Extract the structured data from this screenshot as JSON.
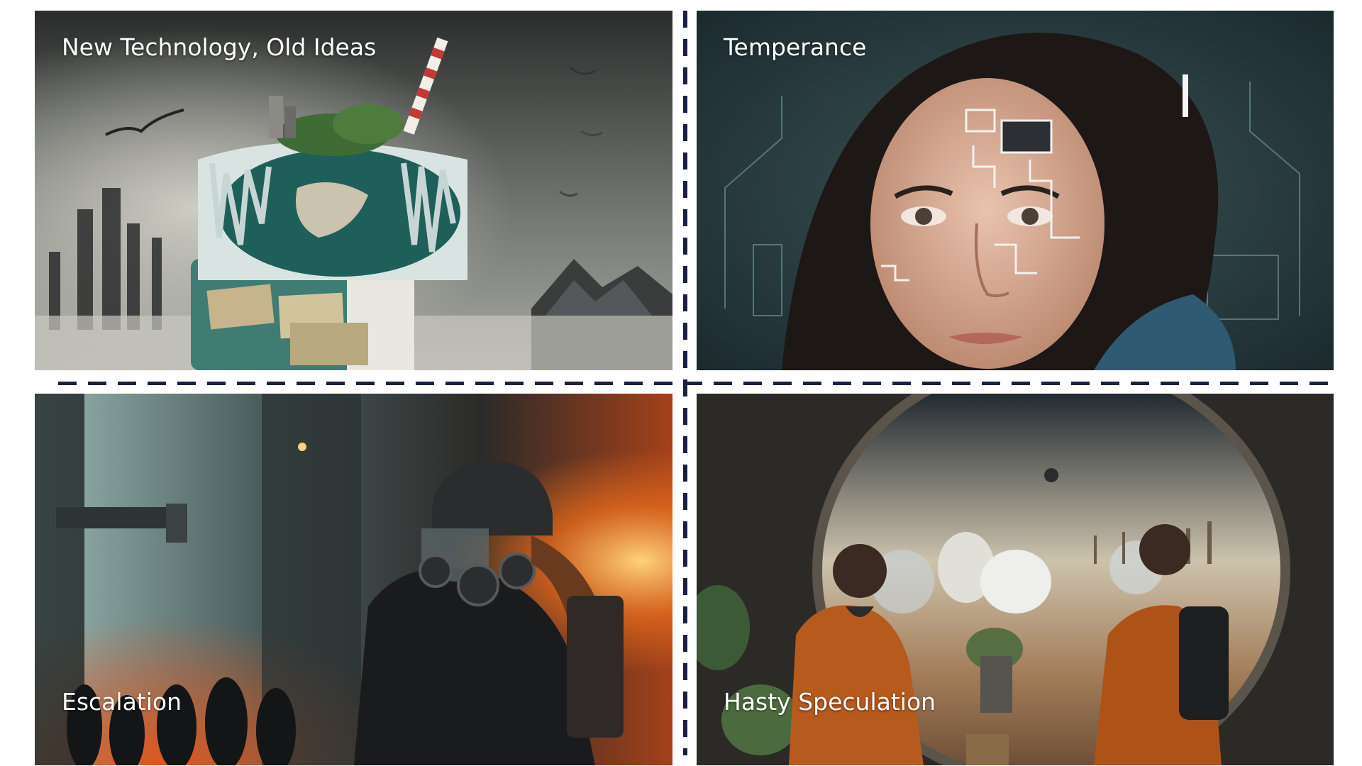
{
  "panels": [
    {
      "title": "New Technology, Old Ideas"
    },
    {
      "title": "Temperance"
    },
    {
      "title": "Escalation"
    },
    {
      "title": "Hasty Speculation"
    }
  ],
  "colors": {
    "divider": "#1a2140",
    "caption_text": "#ffffff"
  }
}
